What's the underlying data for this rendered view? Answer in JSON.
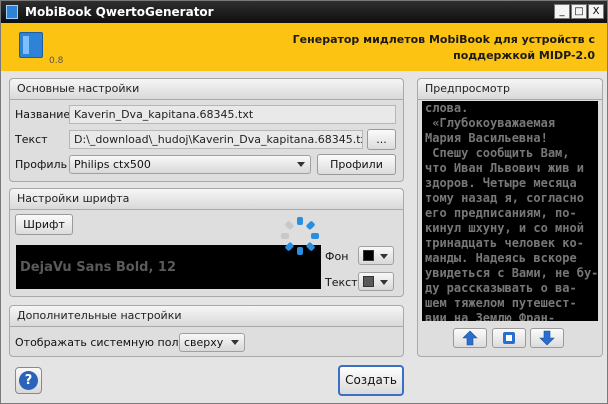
{
  "window": {
    "title": "MobiBook QwertoGenerator",
    "min_glyph": "_",
    "max_glyph": "□",
    "close_glyph": "X"
  },
  "header": {
    "version": "0.8",
    "tagline": "Генератор мидлетов MobiBook для устройств с поддержкой MIDP-2.0",
    "accent_color": "#fdc312"
  },
  "main_settings": {
    "title": "Основные настройки",
    "name_label": "Название",
    "name_value": "Kaverin_Dva_kapitana.68345.txt",
    "text_label": "Текст",
    "text_value": "D:\\_download\\_hudoj\\Kaverin_Dva_kapitana.68345.txt",
    "browse_label": "...",
    "profile_label": "Профиль",
    "profile_value": "Philips ctx500",
    "profiles_button": "Профили"
  },
  "font_settings": {
    "title": "Настройки шрифта",
    "font_button": "Шрифт",
    "font_sample": "DejaVu Sans Bold, 12",
    "bg_label": "Фон",
    "bg_color": "#000000",
    "text_label": "Текст",
    "text_color": "#5a5a5a"
  },
  "extra_settings": {
    "title": "Дополнительные настройки",
    "statusbar_label": "Отображать системную полосу",
    "statusbar_value": "сверху"
  },
  "preview": {
    "title": "Предпросмотр",
    "lines": [
      "слова.",
      " «Глубокоуважаемая",
      "Мария Васильевна!",
      " Спешу сообщить Вам,",
      "что Иван Львович жив и",
      "здоров. Четыре месяца",
      "тому назад я, согласно",
      "его предписаниям, по-",
      "кинул шхуну, и со мной",
      "тринадцать человек ко-",
      "манды. Надеясь вскоре",
      "увидеться с Вами, не бу-",
      "ду рассказывать о ва-",
      "шем тяжелом путешест-",
      "вии на Землю Фран-"
    ],
    "up_icon": "arrow-up-icon",
    "stop_icon": "stop-icon",
    "down_icon": "arrow-down-icon"
  },
  "footer": {
    "help_glyph": "?",
    "create_button": "Создать"
  }
}
